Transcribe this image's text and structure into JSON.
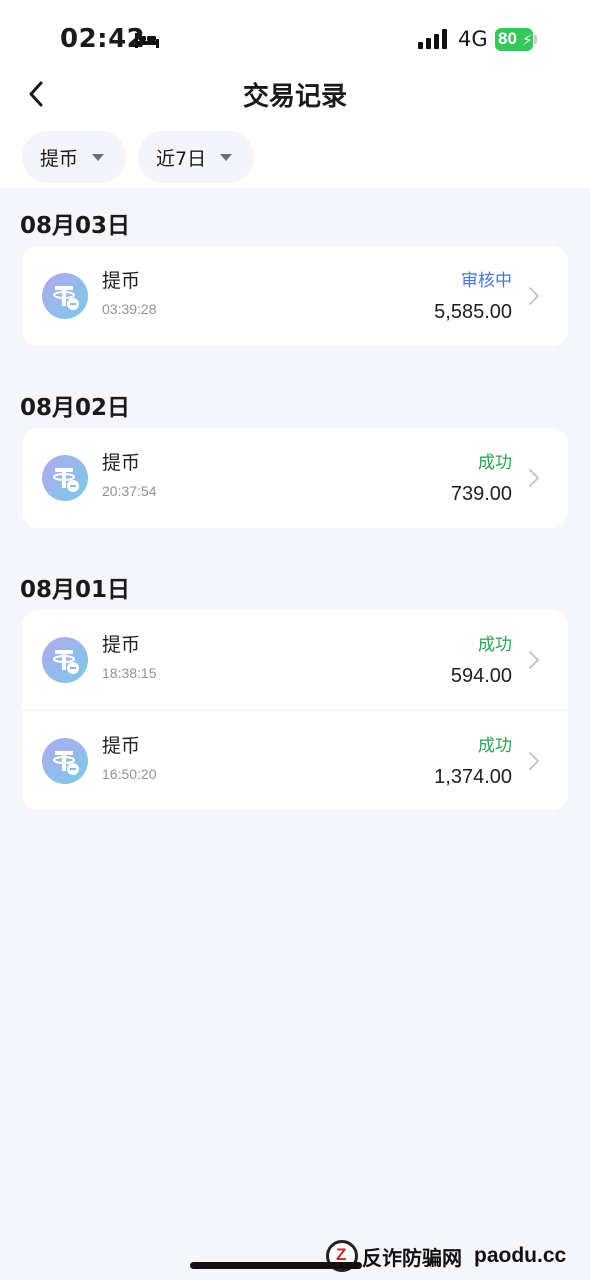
{
  "status_bar": {
    "time": "02:42",
    "network": "4G",
    "battery_level": "80"
  },
  "nav": {
    "title": "交易记录"
  },
  "filters": [
    {
      "label": "提币"
    },
    {
      "label": "近7日"
    }
  ],
  "groups": [
    {
      "date": "08月03日",
      "transactions": [
        {
          "type": "提币",
          "time": "03:39:28",
          "status": "审核中",
          "amount": "5,585.00"
        }
      ]
    },
    {
      "date": "08月02日",
      "transactions": [
        {
          "type": "提币",
          "time": "20:37:54",
          "status": "成功",
          "amount": "739.00"
        }
      ]
    },
    {
      "date": "08月01日",
      "transactions": [
        {
          "type": "提币",
          "time": "18:38:15",
          "status": "成功",
          "amount": "594.00"
        },
        {
          "type": "提币",
          "time": "16:50:20",
          "status": "成功",
          "amount": "1,374.00"
        }
      ]
    }
  ],
  "colors": {
    "status_review": "#4a74d9",
    "status_success": "#2aa157",
    "battery": "#34c759"
  },
  "watermark": {
    "logo_letter": "Z",
    "text": "反诈防骗网",
    "domain": "paodu.cc"
  }
}
